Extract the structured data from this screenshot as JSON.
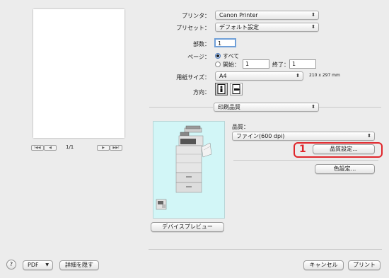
{
  "printer": {
    "label": "プリンタ：",
    "value": "Canon Printer"
  },
  "preset": {
    "label": "プリセット：",
    "value": "デフォルト設定"
  },
  "copies": {
    "label": "部数：",
    "value": "1"
  },
  "pages": {
    "label": "ページ：",
    "all_label": "すべて",
    "from_label": "開始：",
    "from_value": "1",
    "to_label": "終了：",
    "to_value": "1"
  },
  "paper": {
    "label": "用紙サイズ：",
    "value": "A4",
    "dimensions": "210 x 297 mm"
  },
  "orientation": {
    "label": "方向："
  },
  "section_popup": {
    "value": "印刷品質"
  },
  "quality": {
    "label": "品質：",
    "value": "ファイン(600 dpi)",
    "settings_button": "品質設定...",
    "color_button": "色設定...",
    "callout_number": "1",
    "callout_color": "#e0262b"
  },
  "preview": {
    "page_indicator": "1/1",
    "device_preview_button": "デバイスプレビュー",
    "bg_color": "#d2f6f7"
  },
  "bottom": {
    "help": "?",
    "pdf_button": "PDF",
    "hide_details_button": "詳細を隠す",
    "cancel_button": "キャンセル",
    "print_button": "プリント"
  }
}
